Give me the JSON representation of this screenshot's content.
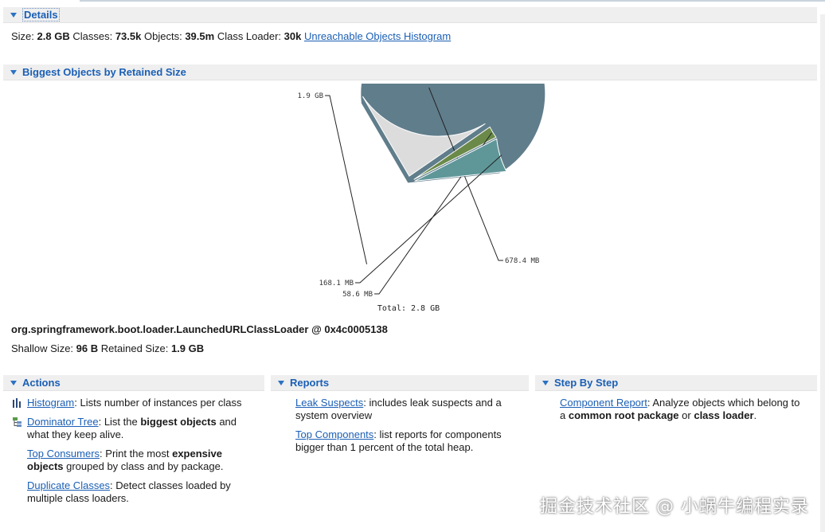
{
  "details": {
    "header": "Details",
    "size_label": "Size:",
    "size_value": "2.8 GB",
    "classes_label": "Classes:",
    "classes_value": "73.5k",
    "objects_label": "Objects:",
    "objects_value": "39.5m",
    "loader_label": "Class Loader:",
    "loader_value": "30k",
    "histogram_link": "Unreachable Objects Histogram"
  },
  "biggest": {
    "header": "Biggest Objects by Retained Size",
    "object_name": "org.springframework.boot.loader.LaunchedURLClassLoader @ 0x4c0005138",
    "shallow_label": "Shallow Size:",
    "shallow_value": "96 B",
    "retained_label": "Retained Size:",
    "retained_value": "1.9 GB"
  },
  "chart_data": {
    "type": "pie",
    "total_label": "Total: 2.8 GB",
    "slices": [
      {
        "label": "1.9 GB",
        "value": 1945.6,
        "color": "#607d8b",
        "exploded": false
      },
      {
        "label": "678.4 MB",
        "value": 678.4,
        "color": "#dcdcdc",
        "exploded": true
      },
      {
        "label": "58.6 MB",
        "value": 58.6,
        "color": "#6b8a4a",
        "exploded": true
      },
      {
        "label": "168.1 MB",
        "value": 168.1,
        "color": "#5f9799",
        "exploded": true
      }
    ]
  },
  "actions": {
    "header": "Actions",
    "histogram_link": "Histogram",
    "histogram_desc": ": Lists number of instances per class",
    "dominator_link": "Dominator Tree",
    "dominator_desc_1": ": List the ",
    "dominator_bold": "biggest objects",
    "dominator_desc_2": " and",
    "dominator_desc_3": "what they keep alive.",
    "top_link": "Top Consumers",
    "top_desc_1": ": Print the most ",
    "top_bold": "expensive",
    "top_bold_2": "objects",
    "top_desc_2": " grouped by class and by package.",
    "dup_link": "Duplicate Classes",
    "dup_desc_1": ": Detect classes loaded by",
    "dup_desc_2": "multiple class loaders."
  },
  "reports": {
    "header": "Reports",
    "leak_link": "Leak Suspects",
    "leak_desc_1": ": includes leak suspects and a",
    "leak_desc_2": "system overview",
    "top_link": "Top Components",
    "top_desc_1": ": list reports for components",
    "top_desc_2": "bigger than 1 percent of the total heap."
  },
  "step": {
    "header": "Step By Step",
    "component_link": "Component Report",
    "component_desc_1": ": Analyze objects which belong to",
    "component_desc_2": "a ",
    "component_bold_1": "common root package",
    "component_desc_3": " or ",
    "component_bold_2": "class loader",
    "component_desc_4": "."
  },
  "watermark": "掘金技术社区 @ 小蜗牛编程实录",
  "colors": {
    "accent": "#1b5fb5",
    "header_bg": "#efefef"
  }
}
